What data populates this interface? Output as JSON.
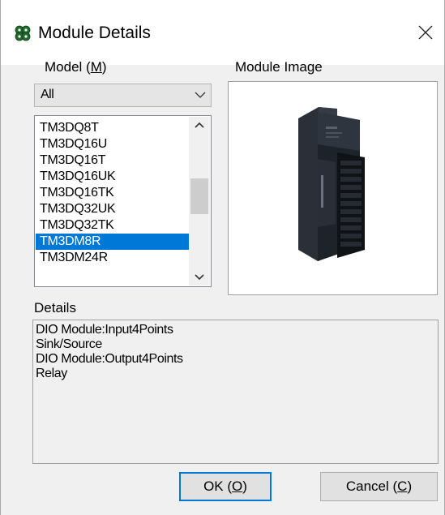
{
  "window": {
    "title": "Module Details",
    "icon": "gear-cluster-icon"
  },
  "model": {
    "label_prefix": "Model (",
    "label_mnemonic": "M",
    "label_suffix": ")",
    "filter_value": "All",
    "items": [
      "TM3DQ8T",
      "TM3DQ16U",
      "TM3DQ16T",
      "TM3DQ16UK",
      "TM3DQ16TK",
      "TM3DQ32UK",
      "TM3DQ32TK",
      "TM3DM8R",
      "TM3DM24R"
    ],
    "selected_item": "TM3DM8R"
  },
  "image": {
    "label": "Module Image"
  },
  "details": {
    "label": "Details",
    "lines": [
      "DIO Module:Input4Points",
      "Sink/Source",
      "DIO Module:Output4Points",
      "Relay"
    ]
  },
  "buttons": {
    "ok_prefix": "OK (",
    "ok_mnemonic": "O",
    "ok_suffix": ")",
    "cancel_prefix": "Cancel (",
    "cancel_mnemonic": "C",
    "cancel_suffix": ")"
  },
  "colors": {
    "selection": "#0078d7",
    "dialog_bg": "#f0f0f0",
    "button_bg": "#e1e1e1"
  }
}
